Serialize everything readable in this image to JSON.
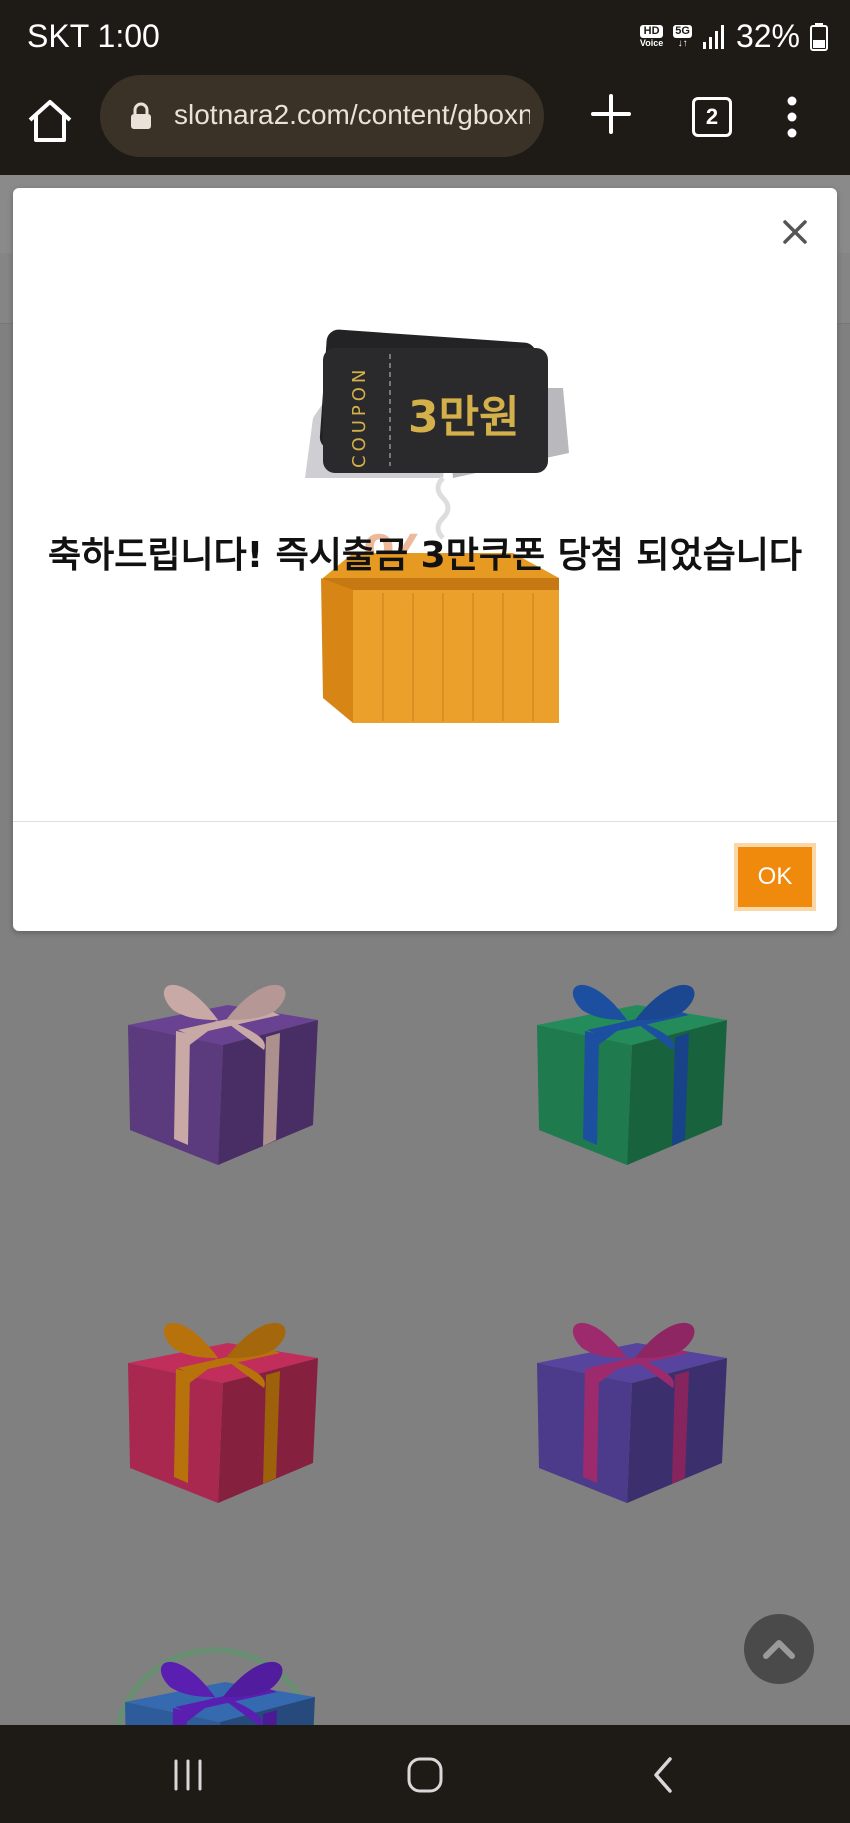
{
  "status_bar": {
    "carrier_time": "SKT 1:00",
    "hd_badge": "HD",
    "voice_label": "Voice",
    "network": "5G",
    "battery": "32%"
  },
  "browser": {
    "url": "slotnara2.com/content/gboxn",
    "tab_count": "2"
  },
  "modal": {
    "coupon_side_text": "COUPON",
    "coupon_amount": "3만원",
    "message": "축하드립니다! 즉시출금 3만쿠폰 당첨 되었습니다",
    "ok_label": "OK"
  },
  "background": {
    "gift_boxes": [
      {
        "box": "#5b3a7e",
        "ribbon": "#c9a9a6"
      },
      {
        "box": "#1f7a4e",
        "ribbon": "#1d4fa0"
      },
      {
        "box": "#a8284f",
        "ribbon": "#b7720c"
      },
      {
        "box": "#4b3b8a",
        "ribbon": "#9e2a6e"
      },
      {
        "box": "#2e5c9a",
        "ribbon": "#5a1fb0"
      }
    ]
  },
  "colors": {
    "ok_button": "#f08a0c",
    "overlay": "#808080",
    "system_bar": "#1e1b17"
  },
  "icons": [
    "home-icon",
    "lock-icon",
    "plus-icon",
    "more-vert-icon",
    "close-icon",
    "chevron-up-icon",
    "recent-apps-icon",
    "home-circle-icon",
    "back-icon"
  ]
}
